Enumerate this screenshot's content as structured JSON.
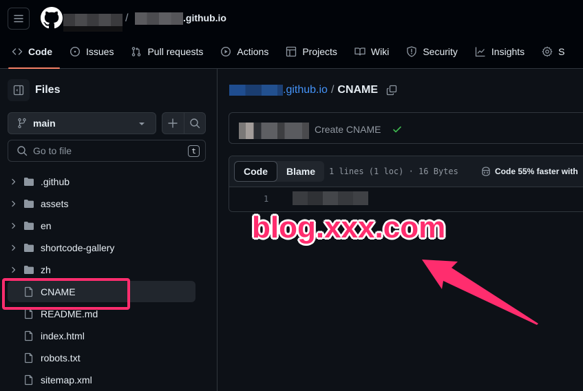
{
  "header": {
    "repo_suffix": ".github.io",
    "slash": "/",
    "tabs": [
      {
        "label": "Code",
        "icon": "code-icon",
        "active": true
      },
      {
        "label": "Issues",
        "icon": "issue-icon"
      },
      {
        "label": "Pull requests",
        "icon": "pull-request-icon"
      },
      {
        "label": "Actions",
        "icon": "play-icon"
      },
      {
        "label": "Projects",
        "icon": "table-icon"
      },
      {
        "label": "Wiki",
        "icon": "book-icon"
      },
      {
        "label": "Security",
        "icon": "shield-icon"
      },
      {
        "label": "Insights",
        "icon": "graph-icon"
      },
      {
        "label": "S",
        "icon": "gear-icon"
      }
    ]
  },
  "sidebar": {
    "title": "Files",
    "branch": "main",
    "search_placeholder": "Go to file",
    "shortcut_key": "t",
    "tree": [
      {
        "name": ".github",
        "type": "folder"
      },
      {
        "name": "assets",
        "type": "folder"
      },
      {
        "name": "en",
        "type": "folder"
      },
      {
        "name": "shortcode-gallery",
        "type": "folder"
      },
      {
        "name": "zh",
        "type": "folder"
      },
      {
        "name": "CNAME",
        "type": "file",
        "selected": true
      },
      {
        "name": "README.md",
        "type": "file"
      },
      {
        "name": "index.html",
        "type": "file"
      },
      {
        "name": "robots.txt",
        "type": "file"
      },
      {
        "name": "sitemap.xml",
        "type": "file"
      }
    ]
  },
  "main": {
    "breadcrumb": {
      "repo_suffix": ".github.io",
      "separator": "/",
      "file": "CNAME"
    },
    "commit": {
      "message": "Create CNAME",
      "status": "success"
    },
    "file_view": {
      "tabs": [
        "Code",
        "Blame"
      ],
      "active_tab": "Code",
      "meta": "1 lines (1 loc) · 16 Bytes",
      "copilot_text": "Code 55% faster with",
      "line_numbers": [
        "1"
      ]
    }
  },
  "annotation": {
    "text": "blog.xxx.com",
    "color": "#ff2d6e"
  },
  "colors": {
    "accent_link": "#4493f8",
    "active_tab_underline": "#f78166",
    "success": "#3fb950",
    "background": "#0d1117",
    "header_bg": "#010409"
  }
}
